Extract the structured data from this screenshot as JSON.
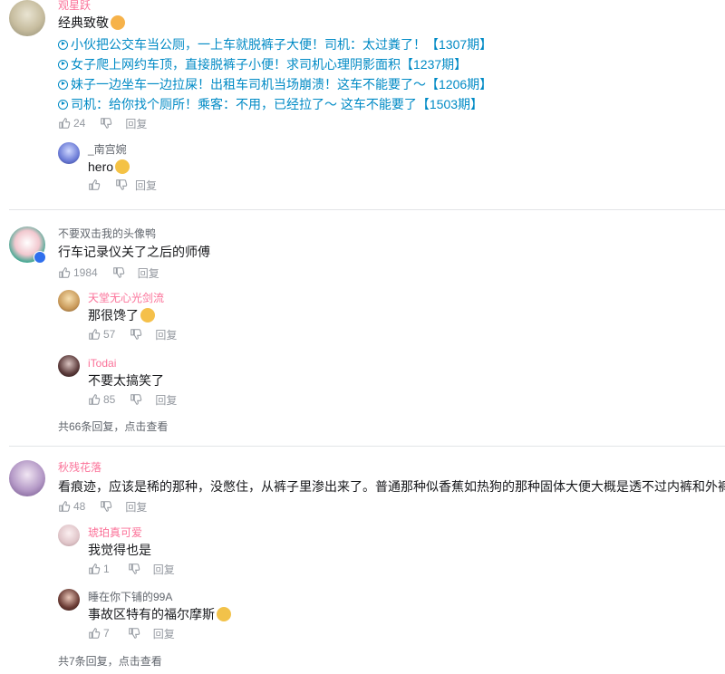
{
  "comments": [
    {
      "user": "观星跃",
      "text": "经典致敬",
      "links": [
        "小伙把公交车当公厕，一上车就脱裤子大便！司机：太过粪了！【1307期】",
        "女子爬上网约车顶，直接脱裤子小便！求司机心理阴影面积【1237期】",
        "妹子一边坐车一边拉屎！出租车司机当场崩溃！这车不能要了～【1206期】",
        "司机：给你找个厕所！乘客：不用，已经拉了～ 这车不能要了【1503期】"
      ],
      "likes": "24",
      "reply_label": "回复",
      "replies": [
        {
          "user": "_南宫婉",
          "text": "hero",
          "likes": "",
          "reply_label": "回复"
        }
      ]
    },
    {
      "user": "不要双击我的头像鸭",
      "text": "行车记录仪关了之后的师傅",
      "likes": "1984",
      "reply_label": "回复",
      "replies": [
        {
          "user": "天堂无心光剑流",
          "text": "那很馋了",
          "likes": "57",
          "reply_label": "回复"
        },
        {
          "user": "iTodai",
          "text": "不要太搞笑了",
          "likes": "85",
          "reply_label": "回复"
        }
      ],
      "more_count": "共66条回复，",
      "more_action": "点击查看"
    },
    {
      "user": "秋残花落",
      "text": "看痕迹，应该是稀的那种，没憋住，从裤子里渗出来了。普通那种似香蕉如热狗的那种固体大便大概是透不过内裤和外裤的。",
      "likes": "48",
      "reply_label": "回复",
      "replies": [
        {
          "user": "琥珀真可爱",
          "text": "我觉得也是",
          "likes": "1",
          "reply_label": "回复"
        },
        {
          "user": "睡在你下铺的99A",
          "text": "事故区特有的福尔摩斯",
          "likes": "7",
          "reply_label": "回复"
        }
      ],
      "more_count": "共7条回复，",
      "more_action": "点击查看"
    }
  ],
  "colors": {
    "vip_name": "#fb7299",
    "normal_name": "#61666d",
    "link": "#008ac5",
    "meta": "#9499a0"
  }
}
